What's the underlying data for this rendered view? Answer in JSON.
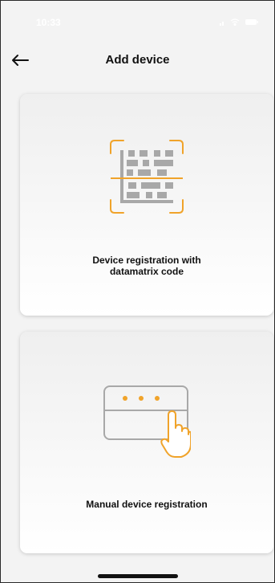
{
  "status_bar": {
    "time": "10:33",
    "icons": [
      "signal-icon",
      "wifi-icon",
      "battery-icon"
    ]
  },
  "header": {
    "back_icon": "arrow-left-icon",
    "title": "Add device"
  },
  "options": [
    {
      "label_line1": "Device registration with",
      "label_line2": "datamatrix code",
      "icon": "datamatrix-scan-icon"
    },
    {
      "label": "Manual device registration",
      "icon": "manual-entry-icon"
    }
  ],
  "colors": {
    "accent": "#f0a32a",
    "background": "#f3f3f3",
    "card_bg": "#ffffff",
    "text": "#111111",
    "icon_grey": "#a8a8a8"
  }
}
